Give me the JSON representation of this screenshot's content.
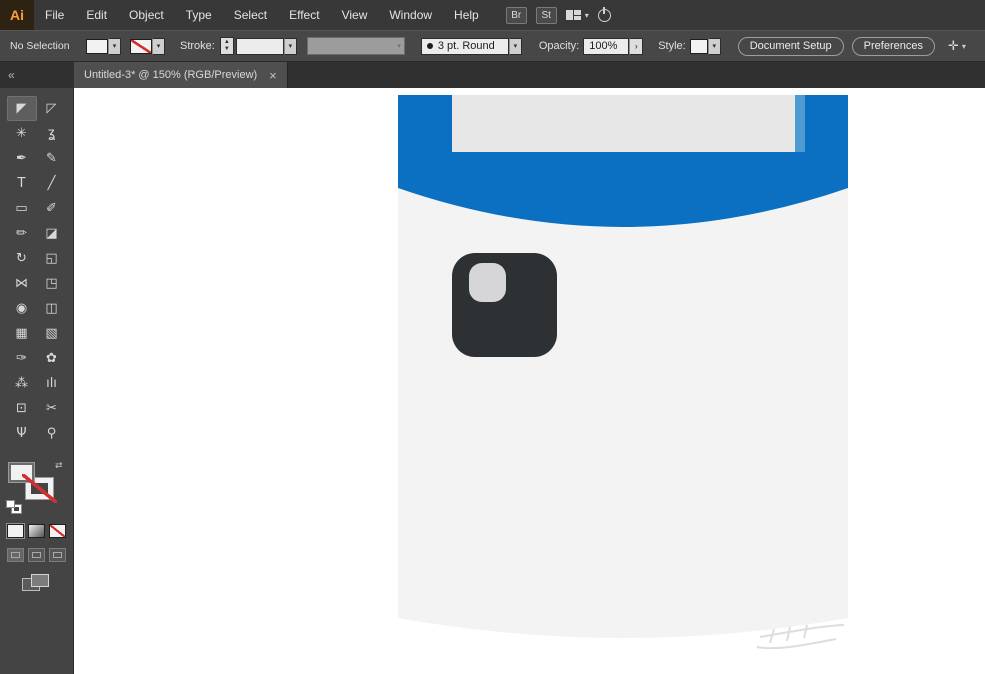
{
  "icons": {
    "caret": "▾",
    "stepper_up": "▲",
    "stepper_down": "▼",
    "arrow": "›",
    "swap": "⇄",
    "collapse": "«",
    "close": "×",
    "align": "✛"
  },
  "menubar": {
    "logo": "Ai",
    "items": [
      "File",
      "Edit",
      "Object",
      "Type",
      "Select",
      "Effect",
      "View",
      "Window",
      "Help"
    ],
    "right": {
      "br_label": "Br",
      "st_label": "St"
    }
  },
  "controlbar": {
    "selection_status": "No Selection",
    "stroke_label": "Stroke:",
    "brush_value": "3 pt. Round",
    "opacity_label": "Opacity:",
    "opacity_value": "100%",
    "style_label": "Style:",
    "document_setup_label": "Document Setup",
    "preferences_label": "Preferences"
  },
  "tabbar": {
    "tab_title": "Untitled-3* @ 150% (RGB/Preview)"
  },
  "toolbar": {
    "tools": [
      {
        "name": "selection-tool",
        "glyph": "◤",
        "selected": true
      },
      {
        "name": "direct-selection-tool",
        "glyph": "◸",
        "selected": false
      },
      {
        "name": "magic-wand-tool",
        "glyph": "✳",
        "selected": false
      },
      {
        "name": "lasso-tool",
        "glyph": "ʓ",
        "selected": false
      },
      {
        "name": "pen-tool",
        "glyph": "✒",
        "selected": false
      },
      {
        "name": "curvature-tool",
        "glyph": "✎",
        "selected": false
      },
      {
        "name": "type-tool",
        "glyph": "T",
        "selected": false
      },
      {
        "name": "line-segment-tool",
        "glyph": "╱",
        "selected": false
      },
      {
        "name": "rectangle-tool",
        "glyph": "▭",
        "selected": false
      },
      {
        "name": "paintbrush-tool",
        "glyph": "✐",
        "selected": false
      },
      {
        "name": "pencil-tool",
        "glyph": "✏",
        "selected": false
      },
      {
        "name": "eraser-tool",
        "glyph": "◪",
        "selected": false
      },
      {
        "name": "rotate-tool",
        "glyph": "↻",
        "selected": false
      },
      {
        "name": "scale-tool",
        "glyph": "◱",
        "selected": false
      },
      {
        "name": "width-tool",
        "glyph": "⋈",
        "selected": false
      },
      {
        "name": "free-transform-tool",
        "glyph": "◳",
        "selected": false
      },
      {
        "name": "shape-builder-tool",
        "glyph": "◉",
        "selected": false
      },
      {
        "name": "perspective-grid-tool",
        "glyph": "◫",
        "selected": false
      },
      {
        "name": "mesh-tool",
        "glyph": "▦",
        "selected": false
      },
      {
        "name": "gradient-tool",
        "glyph": "▧",
        "selected": false
      },
      {
        "name": "eyedropper-tool",
        "glyph": "✑",
        "selected": false
      },
      {
        "name": "blend-tool",
        "glyph": "✿",
        "selected": false
      },
      {
        "name": "symbol-sprayer-tool",
        "glyph": "⁂",
        "selected": false
      },
      {
        "name": "column-graph-tool",
        "glyph": "ılı",
        "selected": false
      },
      {
        "name": "artboard-tool",
        "glyph": "⊡",
        "selected": false
      },
      {
        "name": "slice-tool",
        "glyph": "✂",
        "selected": false
      },
      {
        "name": "hand-tool",
        "glyph": "Ψ",
        "selected": false
      },
      {
        "name": "zoom-tool",
        "glyph": "⚲",
        "selected": false
      }
    ]
  },
  "canvas": {
    "colors": {
      "header": "#0b6fc2",
      "body": "#f3f3f3",
      "screen": "#e7e7e7",
      "screen_edge": "#4e9ad3",
      "camera": "#2e3134",
      "lens": "#d6d6d8",
      "watermark": "#dadada"
    }
  }
}
